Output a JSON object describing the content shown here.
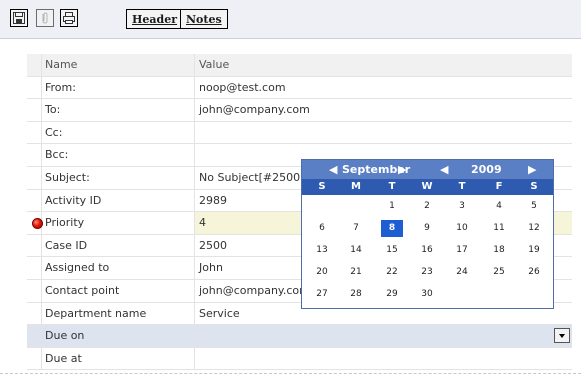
{
  "toolbar": {
    "tabs": {
      "header": "Header",
      "notes": "Notes"
    },
    "icons": {
      "save": "save-icon",
      "attach": "attachment-icon",
      "print": "print-icon"
    }
  },
  "grid": {
    "columns": {
      "name": "Name",
      "value": "Value"
    },
    "rows": [
      {
        "label": "From:",
        "value": "noop@test.com"
      },
      {
        "label": "To:",
        "value": "john@company.com"
      },
      {
        "label": "Cc:",
        "value": ""
      },
      {
        "label": "Bcc:",
        "value": ""
      },
      {
        "label": "Subject:",
        "value": "No Subject[#2500]"
      },
      {
        "label": "Activity ID",
        "value": "2989"
      },
      {
        "label": "Priority",
        "value": "4"
      },
      {
        "label": "Case ID",
        "value": "2500"
      },
      {
        "label": "Assigned to",
        "value": "John"
      },
      {
        "label": "Contact point",
        "value": "john@company.com"
      },
      {
        "label": "Department name",
        "value": "Service"
      },
      {
        "label": "Due on",
        "value": ""
      },
      {
        "label": "Due at",
        "value": ""
      }
    ]
  },
  "calendar": {
    "month": "September",
    "year": "2009",
    "prev_month": "◀",
    "next_month": "▶",
    "prev_year": "◀",
    "next_year": "▶",
    "dow": [
      "S",
      "M",
      "T",
      "W",
      "T",
      "F",
      "S"
    ],
    "weeks": [
      [
        "",
        "",
        "1",
        "2",
        "3",
        "4",
        "5"
      ],
      [
        "6",
        "7",
        "8",
        "9",
        "10",
        "11",
        "12"
      ],
      [
        "13",
        "14",
        "15",
        "16",
        "17",
        "18",
        "19"
      ],
      [
        "20",
        "21",
        "22",
        "23",
        "24",
        "25",
        "26"
      ],
      [
        "27",
        "28",
        "29",
        "30",
        "",
        "",
        ""
      ]
    ],
    "selected_day": "8",
    "colors": {
      "header": "#5a7fc4",
      "dow": "#2e5bb0",
      "selected": "#1e5ed2"
    }
  }
}
